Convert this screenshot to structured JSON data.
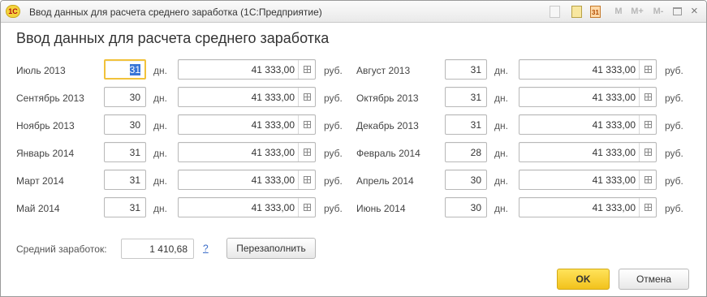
{
  "window": {
    "app_logo": "1С",
    "title": "Ввод данных для расчета среднего заработка  (1С:Предприятие)",
    "toolbar": {
      "m": "M",
      "m_plus": "M+",
      "m_minus": "M-",
      "calendar_label": "31"
    }
  },
  "form": {
    "heading": "Ввод данных для расчета среднего заработка",
    "days_unit": "дн.",
    "currency_unit": "руб.",
    "left_rows": [
      {
        "month": "Июль 2013",
        "days": "31",
        "amount": "41 333,00"
      },
      {
        "month": "Сентябрь 2013",
        "days": "30",
        "amount": "41 333,00"
      },
      {
        "month": "Ноябрь 2013",
        "days": "30",
        "amount": "41 333,00"
      },
      {
        "month": "Январь 2014",
        "days": "31",
        "amount": "41 333,00"
      },
      {
        "month": "Март 2014",
        "days": "31",
        "amount": "41 333,00"
      },
      {
        "month": "Май 2014",
        "days": "31",
        "amount": "41 333,00"
      }
    ],
    "right_rows": [
      {
        "month": "Август 2013",
        "days": "31",
        "amount": "41 333,00"
      },
      {
        "month": "Октябрь 2013",
        "days": "31",
        "amount": "41 333,00"
      },
      {
        "month": "Декабрь 2013",
        "days": "31",
        "amount": "41 333,00"
      },
      {
        "month": "Февраль 2014",
        "days": "28",
        "amount": "41 333,00"
      },
      {
        "month": "Апрель 2014",
        "days": "30",
        "amount": "41 333,00"
      },
      {
        "month": "Июнь 2014",
        "days": "30",
        "amount": "41 333,00"
      }
    ],
    "average": {
      "label": "Средний заработок:",
      "value": "1 410,68",
      "help": "?"
    },
    "refill_button": "Перезаполнить",
    "ok_button": "OK",
    "cancel_button": "Отмена"
  }
}
